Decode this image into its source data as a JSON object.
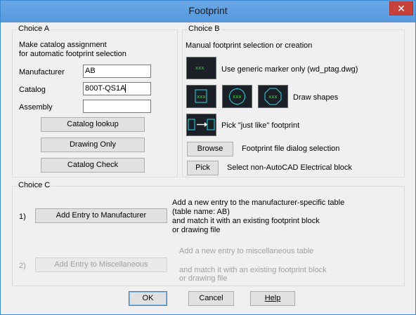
{
  "window": {
    "title": "Footprint",
    "close_glyph": "✕"
  },
  "choice_a": {
    "label": "Choice A",
    "intro_line1": "Make catalog assignment",
    "intro_line2": "for automatic footprint selection",
    "manufacturer_label": "Manufacturer",
    "manufacturer_value": "AB",
    "catalog_label": "Catalog",
    "catalog_value": "800T-QS1A",
    "assembly_label": "Assembly",
    "assembly_value": "",
    "catalog_lookup_label": "Catalog lookup",
    "drawing_only_label": "Drawing Only",
    "catalog_check_label": "Catalog Check"
  },
  "choice_b": {
    "label": "Choice B",
    "intro": "Manual footprint selection or creation",
    "marker_text": "xxx",
    "generic_marker_label": "Use generic marker only (wd_ptag.dwg)",
    "draw_shapes_label": "Draw shapes",
    "just_like_label": "Pick \"just like\" footprint",
    "browse_label": "Browse",
    "browse_desc": "Footprint file dialog selection",
    "pick_label": "Pick",
    "pick_desc": "Select non-AutoCAD Electrical block"
  },
  "choice_c": {
    "label": "Choice C",
    "item1_num": "1)",
    "item1_button": "Add Entry to Manufacturer",
    "item1_desc_line1": "Add a new entry to the manufacturer-specific table",
    "item1_desc_line2": "(table name: AB)",
    "item1_desc_line3": "and match it with an existing footprint block",
    "item1_desc_line4": "or drawing file",
    "item2_num": "2)",
    "item2_button": "Add Entry to Miscellaneous",
    "item2_desc_line1": "Add a new entry to miscellaneous table",
    "item2_desc_line2": "and match it with an existing footprint block",
    "item2_desc_line3": "or drawing file"
  },
  "footer": {
    "ok_label": "OK",
    "cancel_label": "Cancel",
    "help_label": "Help"
  },
  "colors": {
    "title_bar": "#5fa0e0",
    "marker_bg": "#1b2027",
    "marker_fg": "#3fdf3f",
    "shape_stroke": "#2fd6e6"
  }
}
